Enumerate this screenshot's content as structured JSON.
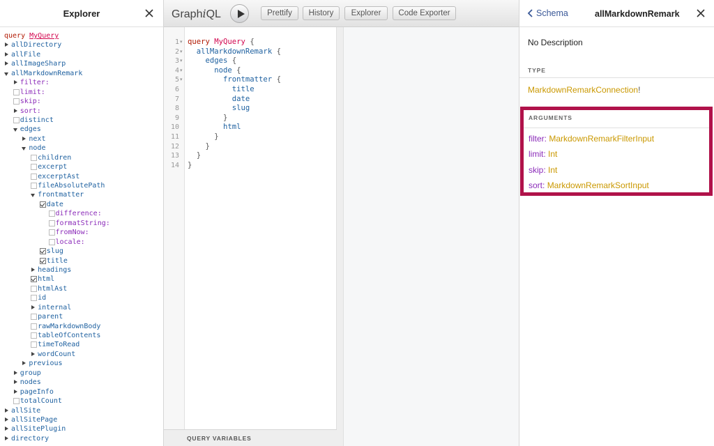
{
  "explorer": {
    "title": "Explorer",
    "query_keyword": "query",
    "query_name": "MyQuery",
    "tree": [
      {
        "d": 0,
        "m": "arrow-right",
        "label": "allDirectory",
        "kind": "field"
      },
      {
        "d": 0,
        "m": "arrow-right",
        "label": "allFile",
        "kind": "field"
      },
      {
        "d": 0,
        "m": "arrow-right",
        "label": "allImageSharp",
        "kind": "field"
      },
      {
        "d": 0,
        "m": "arrow-down",
        "label": "allMarkdownRemark",
        "kind": "field"
      },
      {
        "d": 1,
        "m": "arrow-right",
        "label": "filter:",
        "kind": "arg"
      },
      {
        "d": 1,
        "m": "cb",
        "label": "limit:",
        "kind": "arg"
      },
      {
        "d": 1,
        "m": "cb",
        "label": "skip:",
        "kind": "arg"
      },
      {
        "d": 1,
        "m": "arrow-right",
        "label": "sort:",
        "kind": "arg"
      },
      {
        "d": 1,
        "m": "cb",
        "label": "distinct",
        "kind": "field"
      },
      {
        "d": 1,
        "m": "arrow-down",
        "label": "edges",
        "kind": "field"
      },
      {
        "d": 2,
        "m": "arrow-right",
        "label": "next",
        "kind": "field"
      },
      {
        "d": 2,
        "m": "arrow-down",
        "label": "node",
        "kind": "field"
      },
      {
        "d": 3,
        "m": "cb",
        "label": "children",
        "kind": "field"
      },
      {
        "d": 3,
        "m": "cb",
        "label": "excerpt",
        "kind": "field"
      },
      {
        "d": 3,
        "m": "cb",
        "label": "excerptAst",
        "kind": "field"
      },
      {
        "d": 3,
        "m": "cb",
        "label": "fileAbsolutePath",
        "kind": "field"
      },
      {
        "d": 3,
        "m": "arrow-down",
        "label": "frontmatter",
        "kind": "field"
      },
      {
        "d": 4,
        "m": "cb-checked",
        "label": "date",
        "kind": "field"
      },
      {
        "d": 5,
        "m": "cb",
        "label": "difference:",
        "kind": "arg"
      },
      {
        "d": 5,
        "m": "cb",
        "label": "formatString:",
        "kind": "arg"
      },
      {
        "d": 5,
        "m": "cb",
        "label": "fromNow:",
        "kind": "arg"
      },
      {
        "d": 5,
        "m": "cb",
        "label": "locale:",
        "kind": "arg"
      },
      {
        "d": 4,
        "m": "cb-checked",
        "label": "slug",
        "kind": "field"
      },
      {
        "d": 4,
        "m": "cb-checked",
        "label": "title",
        "kind": "field"
      },
      {
        "d": 3,
        "m": "arrow-right",
        "label": "headings",
        "kind": "field"
      },
      {
        "d": 3,
        "m": "cb-checked",
        "label": "html",
        "kind": "field"
      },
      {
        "d": 3,
        "m": "cb",
        "label": "htmlAst",
        "kind": "field"
      },
      {
        "d": 3,
        "m": "cb",
        "label": "id",
        "kind": "field"
      },
      {
        "d": 3,
        "m": "arrow-right",
        "label": "internal",
        "kind": "field"
      },
      {
        "d": 3,
        "m": "cb",
        "label": "parent",
        "kind": "field"
      },
      {
        "d": 3,
        "m": "cb",
        "label": "rawMarkdownBody",
        "kind": "field"
      },
      {
        "d": 3,
        "m": "cb",
        "label": "tableOfContents",
        "kind": "field"
      },
      {
        "d": 3,
        "m": "cb",
        "label": "timeToRead",
        "kind": "field"
      },
      {
        "d": 3,
        "m": "arrow-right",
        "label": "wordCount",
        "kind": "field"
      },
      {
        "d": 2,
        "m": "arrow-right",
        "label": "previous",
        "kind": "field"
      },
      {
        "d": 1,
        "m": "arrow-right",
        "label": "group",
        "kind": "field"
      },
      {
        "d": 1,
        "m": "arrow-right",
        "label": "nodes",
        "kind": "field"
      },
      {
        "d": 1,
        "m": "arrow-right",
        "label": "pageInfo",
        "kind": "field"
      },
      {
        "d": 1,
        "m": "cb",
        "label": "totalCount",
        "kind": "field"
      },
      {
        "d": 0,
        "m": "arrow-right",
        "label": "allSite",
        "kind": "field"
      },
      {
        "d": 0,
        "m": "arrow-right",
        "label": "allSitePage",
        "kind": "field"
      },
      {
        "d": 0,
        "m": "arrow-right",
        "label": "allSitePlugin",
        "kind": "field"
      },
      {
        "d": 0,
        "m": "arrow-right",
        "label": "directory",
        "kind": "field"
      }
    ]
  },
  "toolbar": {
    "logo_pre": "Graph",
    "logo_i": "i",
    "logo_post": "QL",
    "buttons": [
      "Prettify",
      "History",
      "Explorer",
      "Code Exporter"
    ]
  },
  "editor": {
    "line_numbers": [
      "1",
      "2",
      "3",
      "4",
      "5",
      "6",
      "7",
      "8",
      "9",
      "10",
      "11",
      "12",
      "13",
      "14"
    ],
    "lines": [
      [
        {
          "t": "query",
          "c": "kw"
        },
        {
          "t": " "
        },
        {
          "t": "MyQuery",
          "c": "def"
        },
        {
          "t": " {"
        }
      ],
      [
        {
          "t": "  "
        },
        {
          "t": "allMarkdownRemark",
          "c": "prop"
        },
        {
          "t": " {"
        }
      ],
      [
        {
          "t": "    "
        },
        {
          "t": "edges",
          "c": "prop"
        },
        {
          "t": " {"
        }
      ],
      [
        {
          "t": "      "
        },
        {
          "t": "node",
          "c": "prop"
        },
        {
          "t": " {"
        }
      ],
      [
        {
          "t": "        "
        },
        {
          "t": "frontmatter",
          "c": "prop"
        },
        {
          "t": " {"
        }
      ],
      [
        {
          "t": "          "
        },
        {
          "t": "title",
          "c": "prop"
        }
      ],
      [
        {
          "t": "          "
        },
        {
          "t": "date",
          "c": "prop"
        }
      ],
      [
        {
          "t": "          "
        },
        {
          "t": "slug",
          "c": "prop"
        }
      ],
      [
        {
          "t": "        }"
        }
      ],
      [
        {
          "t": "        "
        },
        {
          "t": "html",
          "c": "prop"
        }
      ],
      [
        {
          "t": "      }"
        }
      ],
      [
        {
          "t": "    }"
        }
      ],
      [
        {
          "t": "  }"
        }
      ],
      [
        {
          "t": "}"
        }
      ]
    ],
    "query_variables": "QUERY VARIABLES"
  },
  "doc": {
    "back_label": "Schema",
    "title": "allMarkdownRemark",
    "description": "No Description",
    "type_section": "TYPE",
    "type_name": "MarkdownRemarkConnection",
    "type_suffix": "!",
    "args_section": "ARGUMENTS",
    "args": [
      {
        "name": "filter",
        "type": "MarkdownRemarkFilterInput"
      },
      {
        "name": "limit",
        "type": "Int"
      },
      {
        "name": "skip",
        "type": "Int"
      },
      {
        "name": "sort",
        "type": "MarkdownRemarkSortInput"
      }
    ]
  }
}
